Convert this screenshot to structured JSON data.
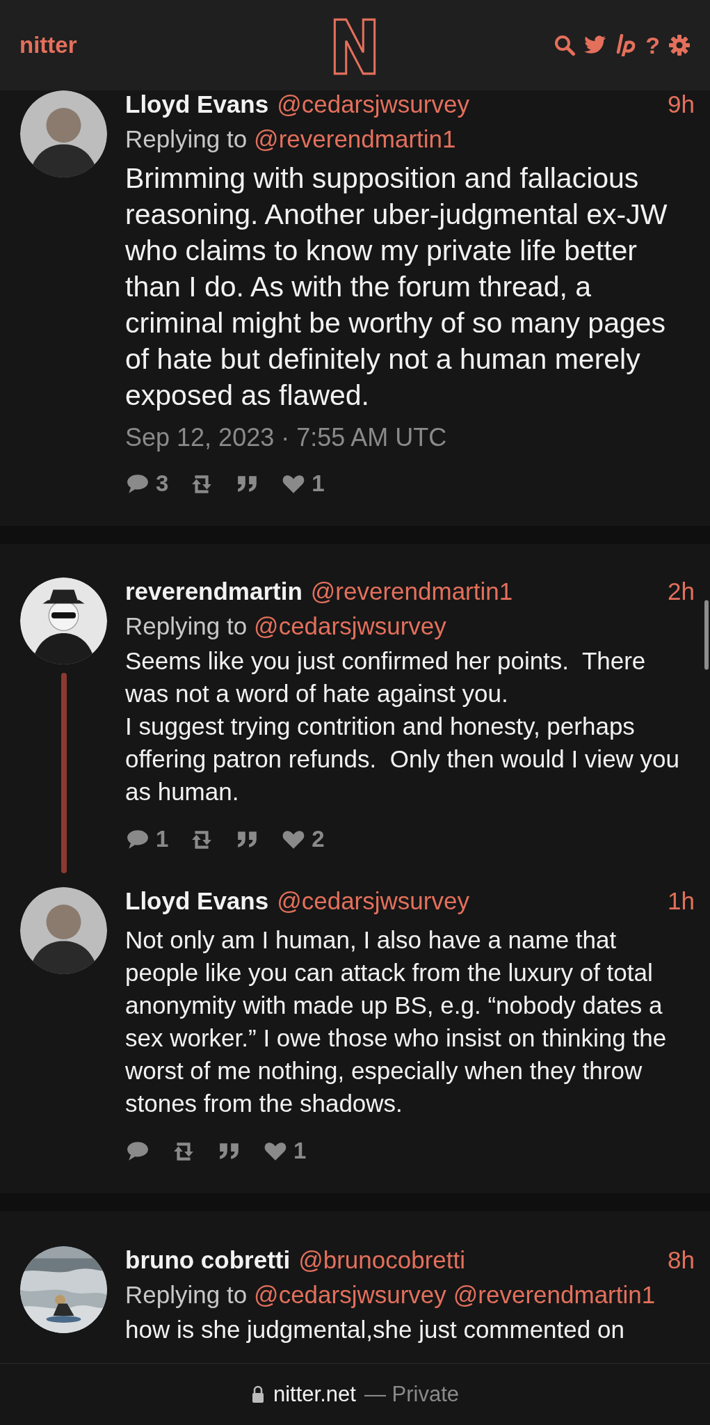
{
  "header": {
    "logo_text": "nitter",
    "help": "?"
  },
  "timeline": [
    {
      "tweets": [
        {
          "name": "Lloyd Evans",
          "handle": "@cedarsjwsurvey",
          "time": "9h",
          "avatar": {
            "kind": "silhouette"
          },
          "replying_label": "Replying to",
          "replying_to": [
            "@reverendmartin1"
          ],
          "main": true,
          "text": "Brimming with supposition and fallacious reasoning. Another uber-judgmental ex-JW who claims to know my private life better than I do. As with the forum thread, a criminal might be worthy of so many pages of hate but definitely not a human merely exposed as flawed.",
          "date": "Sep 12, 2023 · 7:55 AM UTC",
          "stats": {
            "replies": "3",
            "likes": "1"
          }
        }
      ]
    },
    {
      "tweets": [
        {
          "name": "reverendmartin",
          "handle": "@reverendmartin1",
          "time": "2h",
          "avatar": {
            "kind": "hat"
          },
          "replying_label": "Replying to",
          "replying_to": [
            "@cedarsjwsurvey"
          ],
          "main": false,
          "text": "Seems like you just confirmed her points.  There was not a word of hate against you.\nI suggest trying contrition and honesty, perhaps offering patron refunds.  Only then would I view you as human.",
          "stats": {
            "replies": "1",
            "likes": "2"
          }
        },
        {
          "name": "Lloyd Evans",
          "handle": "@cedarsjwsurvey",
          "time": "1h",
          "avatar": {
            "kind": "silhouette"
          },
          "main": false,
          "text": "Not only am I human, I also have a name that people like you can attack from the luxury of total anonymity with made up BS, e.g. “nobody dates a sex worker.” I owe those who insist on thinking the worst of me nothing, especially when they throw stones from the shadows.",
          "stats": {
            "likes": "1"
          }
        }
      ]
    },
    {
      "tweets": [
        {
          "name": "bruno cobretti",
          "handle": "@brunocobretti",
          "time": "8h",
          "avatar": {
            "kind": "picture"
          },
          "replying_label": "Replying to",
          "replying_to": [
            "@cedarsjwsurvey",
            "@reverendmartin1"
          ],
          "main": false,
          "text": "how is she judgmental,she just commented on"
        }
      ]
    }
  ],
  "bottom_bar": {
    "domain": "nitter.net",
    "suffix": "— Private"
  }
}
